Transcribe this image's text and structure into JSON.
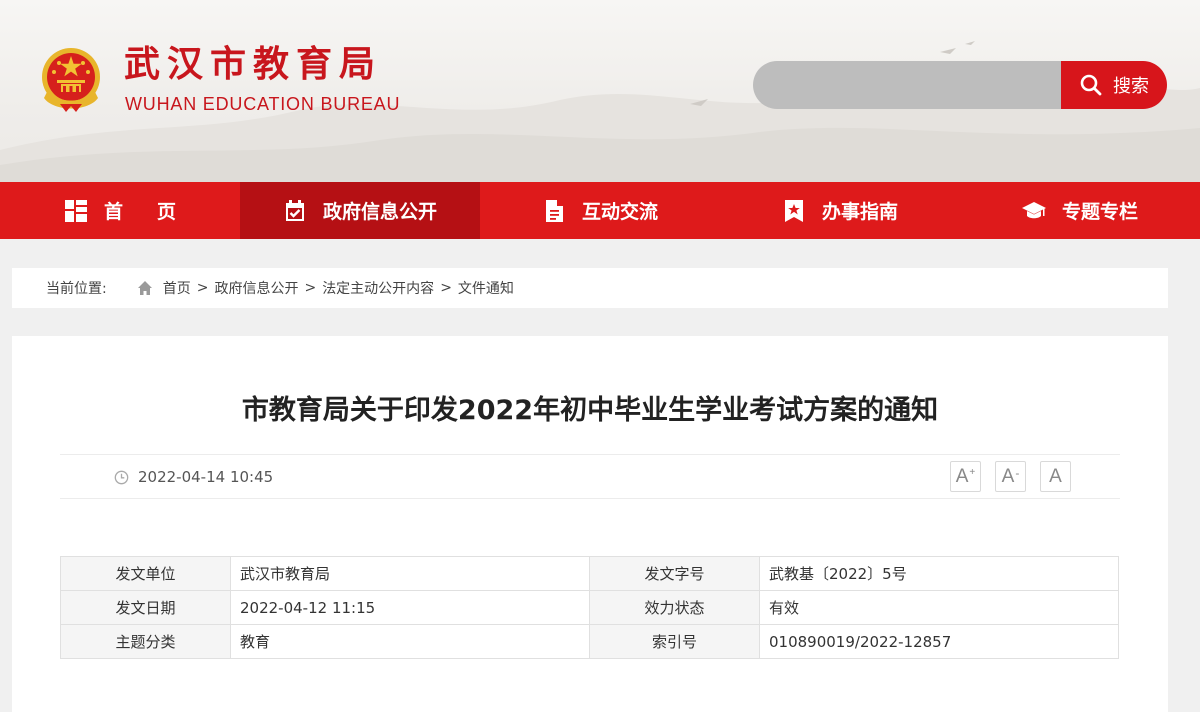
{
  "site": {
    "name_cn": "武汉市教育局",
    "name_en": "WUHAN EDUCATION BUREAU"
  },
  "search": {
    "placeholder": "",
    "button_label": "搜索"
  },
  "nav": {
    "items": [
      {
        "label": "首页",
        "icon": "home-grid-icon"
      },
      {
        "label": "政府信息公开",
        "icon": "calendar-check-icon",
        "active": true
      },
      {
        "label": "互动交流",
        "icon": "document-icon"
      },
      {
        "label": "办事指南",
        "icon": "bookmark-star-icon"
      },
      {
        "label": "专题专栏",
        "icon": "graduation-cap-icon"
      }
    ]
  },
  "breadcrumb": {
    "label": "当前位置:",
    "items": [
      "首页",
      "政府信息公开",
      "法定主动公开内容",
      "文件通知"
    ],
    "separator": ">"
  },
  "article": {
    "title": "市教育局关于印发2022年初中毕业生学业考试方案的通知",
    "date": "2022-04-14 10:45",
    "font_controls": [
      "A+",
      "A-",
      "A"
    ]
  },
  "info": {
    "rows": [
      {
        "k1": "发文单位",
        "v1": "武汉市教育局",
        "k2": "发文字号",
        "v2": "武教基〔2022〕5号"
      },
      {
        "k1": "发文日期",
        "v1": "2022-04-12 11:15",
        "k2": "效力状态",
        "v2": "有效"
      },
      {
        "k1": "主题分类",
        "v1": "教育",
        "k2": "索引号",
        "v2": "010890019/2022-12857"
      }
    ]
  },
  "colors": {
    "brand_red": "#de1a1b",
    "nav_active": "#b51014",
    "search_red": "#d7151b"
  }
}
